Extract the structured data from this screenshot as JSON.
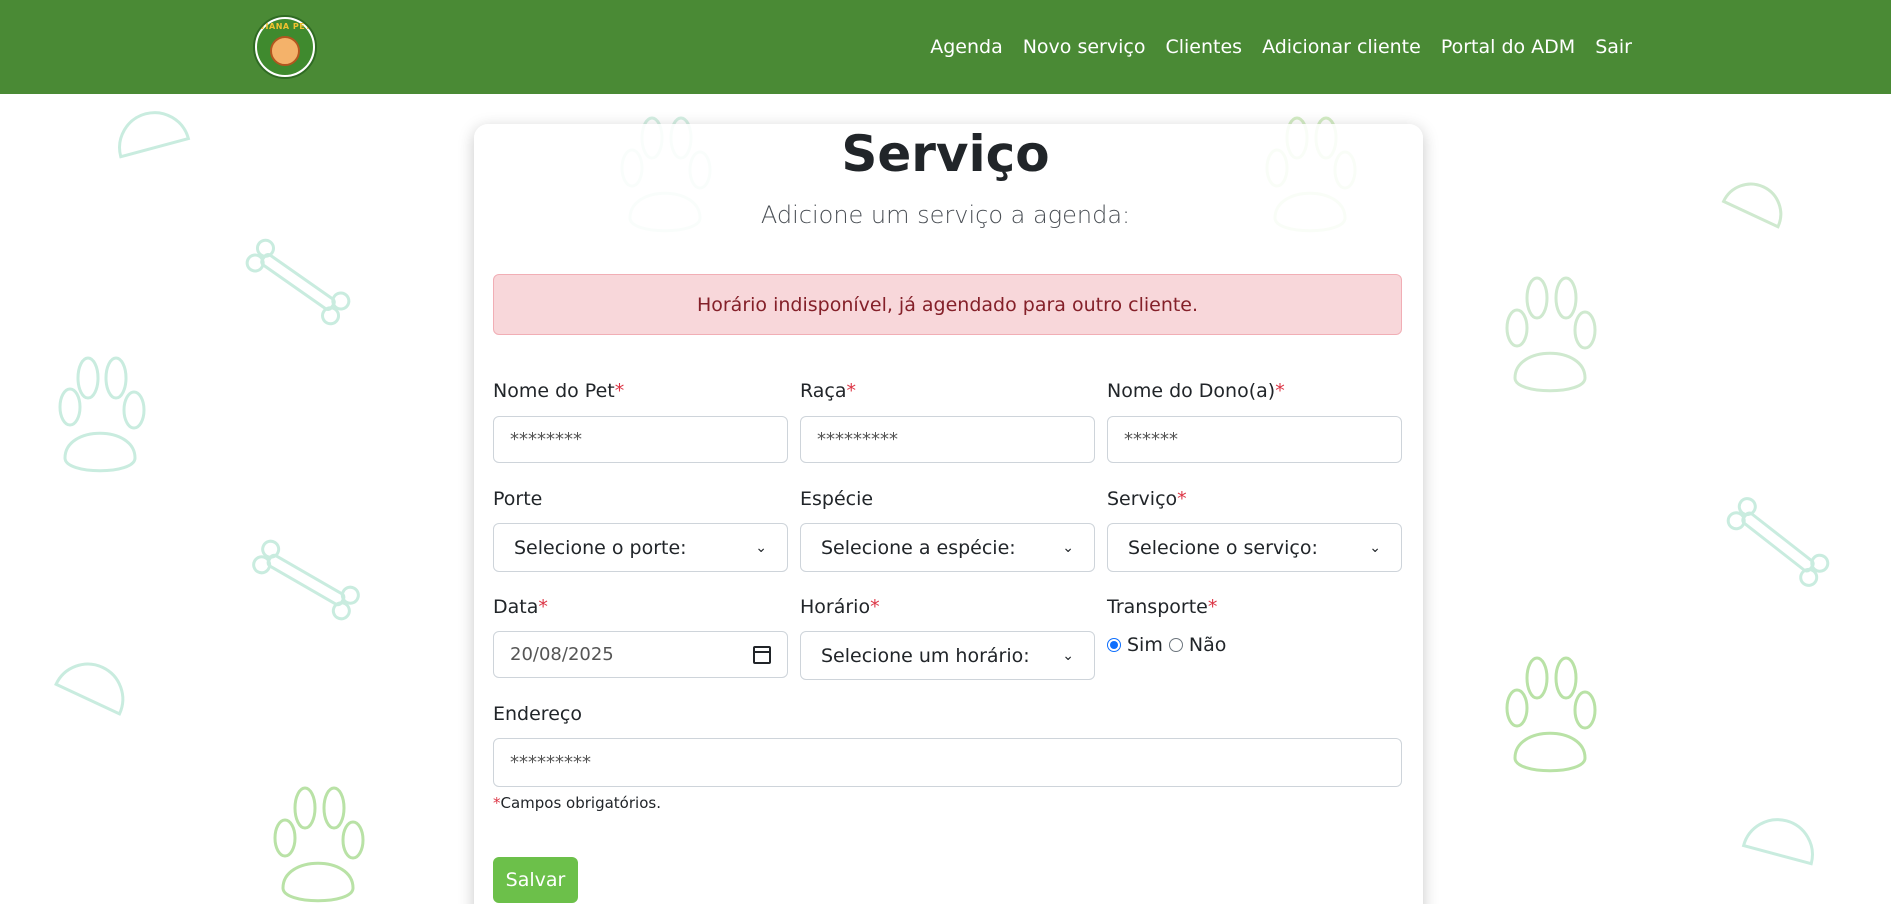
{
  "nav": {
    "logo_text": "VIANA PET",
    "links": [
      "Agenda",
      "Novo serviço",
      "Clientes",
      "Adicionar cliente",
      "Portal do ADM",
      "Sair"
    ]
  },
  "page": {
    "title": "Serviço",
    "subtitle": "Adicione um serviço a agenda:"
  },
  "alert": {
    "message": "Horário indisponível, já agendado para outro cliente."
  },
  "form": {
    "pet_name": {
      "label": "Nome do Pet",
      "value": "********"
    },
    "breed": {
      "label": "Raça",
      "value": "*********"
    },
    "owner_name": {
      "label": "Nome do Dono(a)",
      "value": "******"
    },
    "size": {
      "label": "Porte",
      "selected": "Selecione o porte:"
    },
    "species": {
      "label": "Espécie",
      "selected": "Selecione a espécie:"
    },
    "service": {
      "label": "Serviço",
      "selected": "Selecione o serviço:"
    },
    "date": {
      "label": "Data",
      "value": "20/08/2025"
    },
    "time": {
      "label": "Horário",
      "selected": "Selecione um horário:"
    },
    "transport": {
      "label": "Transporte",
      "options": [
        "Sim",
        "Não"
      ],
      "selected": "Sim"
    },
    "address": {
      "label": "Endereço",
      "value": "*********"
    },
    "required_marker": "*",
    "required_note": "Campos obrigatórios.",
    "save_label": "Salvar"
  },
  "colors": {
    "navbar": "#4a8a35",
    "alert_bg": "#f8d7da",
    "alert_text": "#842029",
    "save_button": "#6cc04a",
    "required": "#dc3545"
  }
}
